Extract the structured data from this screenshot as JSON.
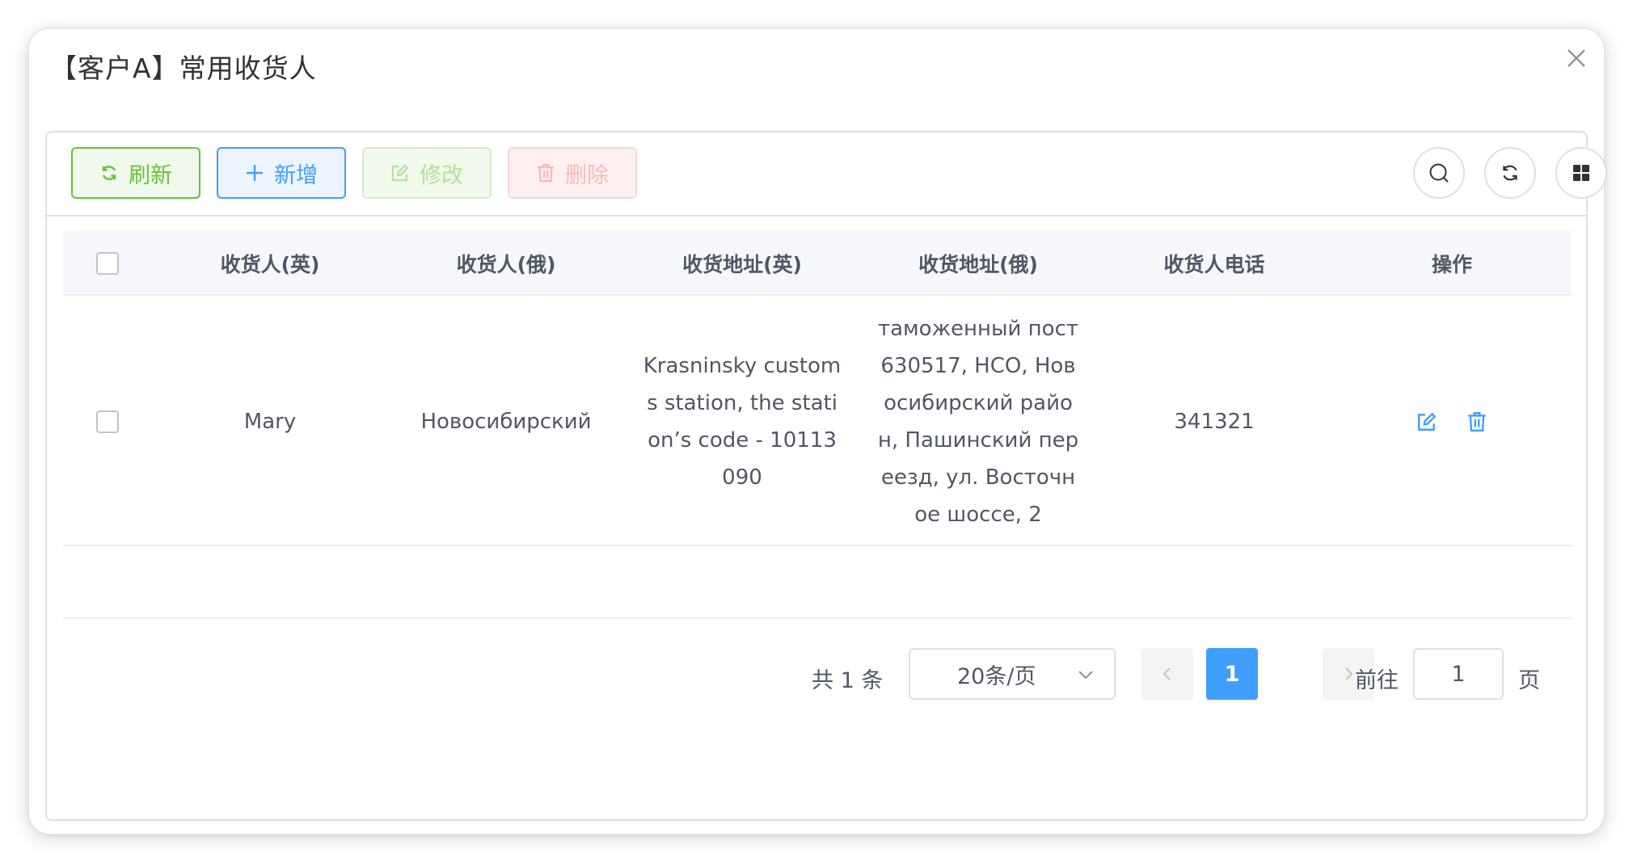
{
  "dialog": {
    "title": "【客户A】常用收货人"
  },
  "toolbar": {
    "refresh_label": "刷新",
    "add_label": "新增",
    "edit_label": "修改",
    "delete_label": "删除"
  },
  "table": {
    "headers": [
      "收货人(英)",
      "收货人(俄)",
      "收货地址(英)",
      "收货地址(俄)",
      "收货人电话",
      "操作"
    ],
    "rows": [
      {
        "consignee_en": "Mary",
        "consignee_ru": "Новосибирский",
        "address_en": "Krasninsky customs station, the station’s code - 10113090",
        "address_ru": "таможенный пост 630517, НСО, Новосибирский район, Пашинский переезд, ул. Восточное шоссе, 2",
        "phone": "341321"
      }
    ]
  },
  "pagination": {
    "total_text": "共 1 条",
    "page_size": "20条/页",
    "current_page": "1",
    "goto_label": "前往",
    "goto_value": "1",
    "page_suffix": "页"
  },
  "colors": {
    "primary": "#409eff",
    "success": "#67c23a",
    "danger": "#f56c6c",
    "header_bg": "#f5f7fa"
  },
  "icons": {
    "close": "close-icon",
    "refresh": "refresh-icon",
    "add": "plus-icon",
    "edit": "edit-icon",
    "delete": "trash-icon",
    "search": "search-icon",
    "reload": "reload-icon",
    "columns": "grid-icon"
  }
}
